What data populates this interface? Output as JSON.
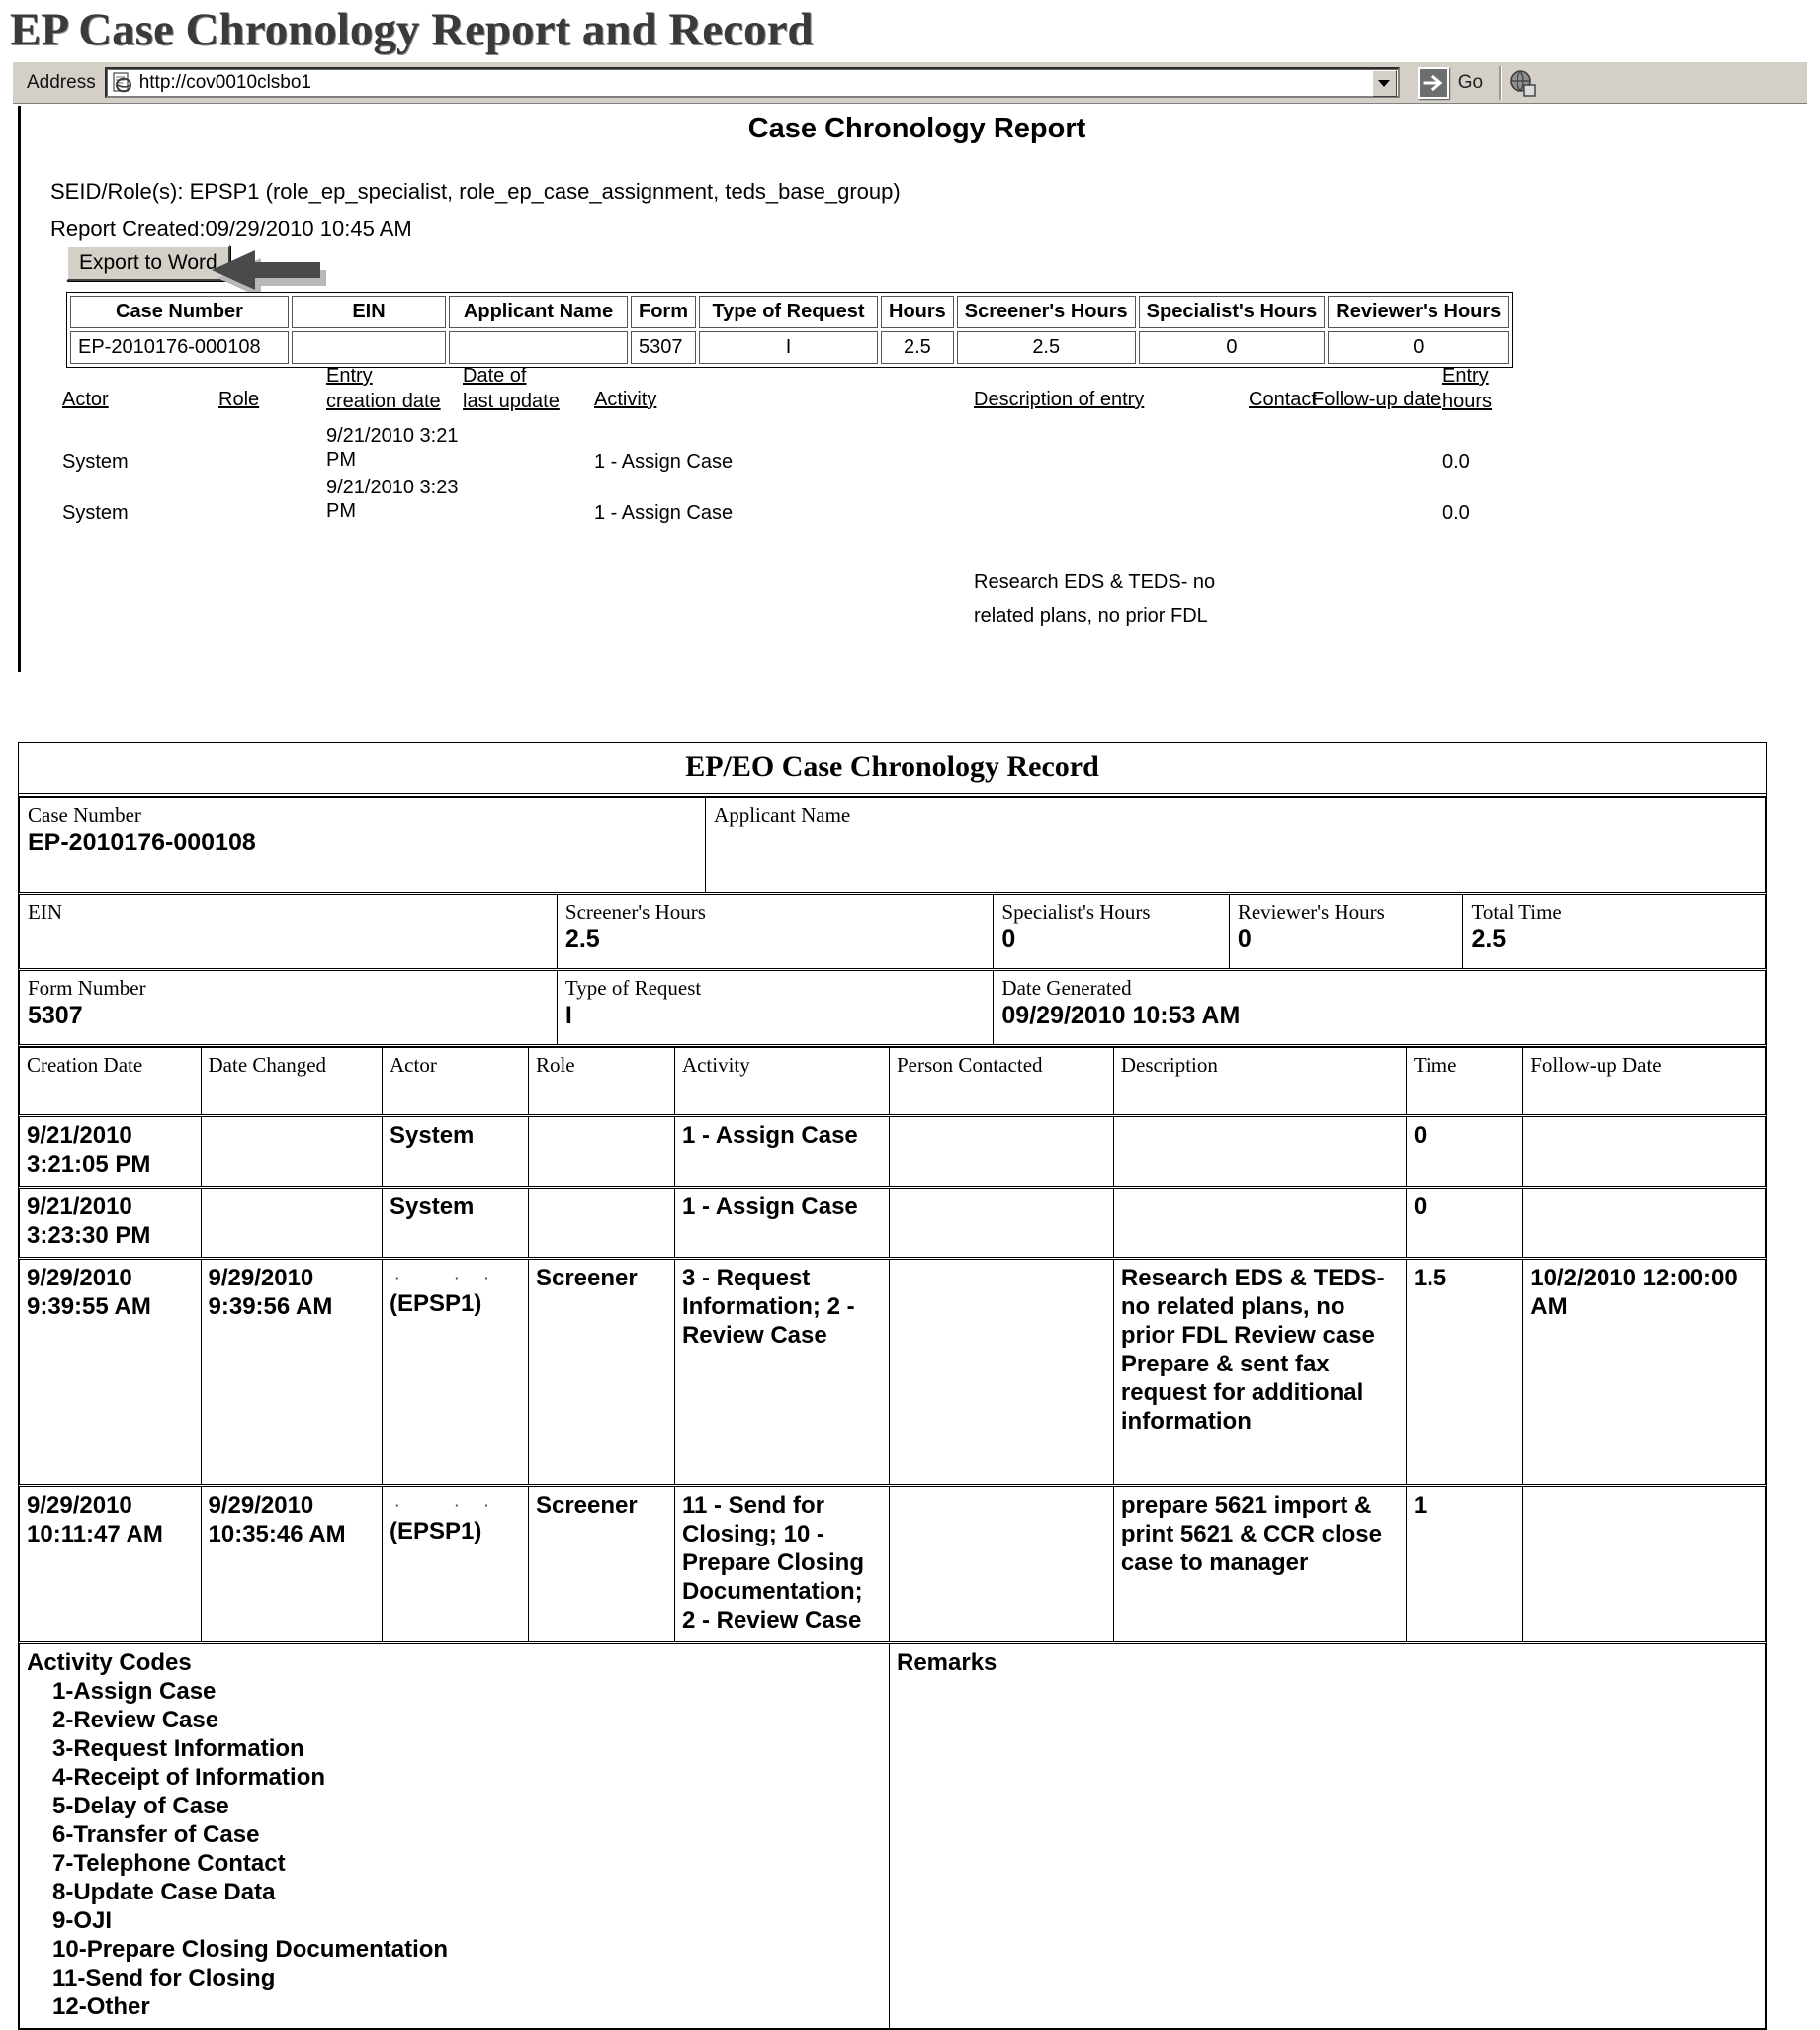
{
  "page": {
    "heading": "EP Case Chronology Report and Record"
  },
  "browser": {
    "address_label": "Address",
    "url": "http://cov0010clsbo1",
    "go_label": "Go"
  },
  "report": {
    "title": "Case Chronology Report",
    "seid_line": "SEID/Role(s): EPSP1   (role_ep_specialist, role_ep_case_assignment, teds_base_group)",
    "created_line": "Report Created:09/29/2010 10:45 AM",
    "export_button": "Export to Word",
    "summary_headers": [
      "Case Number",
      "EIN",
      "Applicant Name",
      "Form",
      "Type of Request",
      "Hours",
      "Screener's Hours",
      "Specialist's Hours",
      "Reviewer's Hours"
    ],
    "summary_row": {
      "case_number": "EP-2010176-000108",
      "ein": "",
      "applicant_name": "",
      "form": "5307",
      "type_of_request": "I",
      "hours": "2.5",
      "screeners_hours": "2.5",
      "specialists_hours": "0",
      "reviewers_hours": "0"
    },
    "flow_headers": {
      "actor": "Actor",
      "role": "Role",
      "entry_creation_date": "Entry creation date",
      "date_of_last_update": "Date of last update",
      "activity": "Activity",
      "description_of_entry": "Description of entry",
      "contact": "Contact",
      "follow_up_date": "Follow-up date",
      "entry_hours": "Entry hours"
    },
    "flow_rows": [
      {
        "actor": "System",
        "role": "",
        "entry_creation_date": "9/21/2010 3:21 PM",
        "date_of_last_update": "",
        "activity": "1 - Assign Case",
        "description": "",
        "contact": "",
        "follow_up": "",
        "entry_hours": "0.0"
      },
      {
        "actor": "System",
        "role": "",
        "entry_creation_date": "9/21/2010 3:23 PM",
        "date_of_last_update": "",
        "activity": "1 - Assign Case",
        "description": "",
        "contact": "",
        "follow_up": "",
        "entry_hours": "0.0"
      }
    ],
    "flow_note": "Research EDS & TEDS- no related plans, no prior FDL"
  },
  "record": {
    "title": "EP/EO Case Chronology Record",
    "fields": {
      "case_number_label": "Case Number",
      "case_number_value": "EP-2010176-000108",
      "applicant_name_label": "Applicant Name",
      "applicant_name_value": "",
      "ein_label": "EIN",
      "ein_value": "",
      "screeners_hours_label": "Screener's Hours",
      "screeners_hours_value": "2.5",
      "specialists_hours_label": "Specialist's Hours",
      "specialists_hours_value": "0",
      "reviewers_hours_label": "Reviewer's Hours",
      "reviewers_hours_value": "0",
      "total_time_label": "Total Time",
      "total_time_value": "2.5",
      "form_number_label": "Form Number",
      "form_number_value": "5307",
      "type_of_request_label": "Type of Request",
      "type_of_request_value": "I",
      "date_generated_label": "Date Generated",
      "date_generated_value": "09/29/2010 10:53 AM"
    },
    "table_headers": [
      "Creation Date",
      "Date Changed",
      "Actor",
      "Role",
      "Activity",
      "Person Contacted",
      "Description",
      "Time",
      "Follow-up Date"
    ],
    "rows": [
      {
        "creation_date": "9/21/2010 3:21:05 PM",
        "date_changed": "",
        "actor": "System",
        "actor_redacted": false,
        "actor_alias": "",
        "role": "",
        "activity": "1 - Assign Case",
        "person_contacted": "",
        "description": "",
        "time": "0",
        "follow_up_date": ""
      },
      {
        "creation_date": "9/21/2010 3:23:30 PM",
        "date_changed": "",
        "actor": "System",
        "actor_redacted": false,
        "actor_alias": "",
        "role": "",
        "activity": "1 - Assign Case",
        "person_contacted": "",
        "description": "",
        "time": "0",
        "follow_up_date": ""
      },
      {
        "creation_date": "9/29/2010 9:39:55 AM",
        "date_changed": "9/29/2010 9:39:56 AM",
        "actor": "",
        "actor_redacted": true,
        "actor_alias": "(EPSP1)",
        "role": "Screener",
        "activity": "3 - Request Information; 2 - Review Case",
        "person_contacted": "",
        "description": "Research EDS & TEDS- no related plans, no prior FDL Review case Prepare & sent fax request for additional information",
        "time": "1.5",
        "follow_up_date": "10/2/2010 12:00:00 AM"
      },
      {
        "creation_date": "9/29/2010 10:11:47 AM",
        "date_changed": "9/29/2010 10:35:46 AM",
        "actor": "",
        "actor_redacted": true,
        "actor_alias": "(EPSP1)",
        "role": "Screener",
        "activity": "11 - Send for Closing; 10 - Prepare Closing Documentation; 2 - Review Case",
        "person_contacted": "",
        "description": "prepare 5621 import & print 5621 & CCR  close case to manager",
        "time": "1",
        "follow_up_date": ""
      }
    ],
    "activity_codes_label": "Activity Codes",
    "activity_codes": [
      "1-Assign Case",
      "2-Review Case",
      "3-Request Information",
      "4-Receipt of Information",
      "5-Delay of Case",
      "6-Transfer of Case",
      "7-Telephone Contact",
      "8-Update Case Data",
      "9-OJI",
      "10-Prepare Closing Documentation",
      "11-Send for Closing",
      "12-Other"
    ],
    "remarks_label": "Remarks",
    "remarks_value": ""
  }
}
